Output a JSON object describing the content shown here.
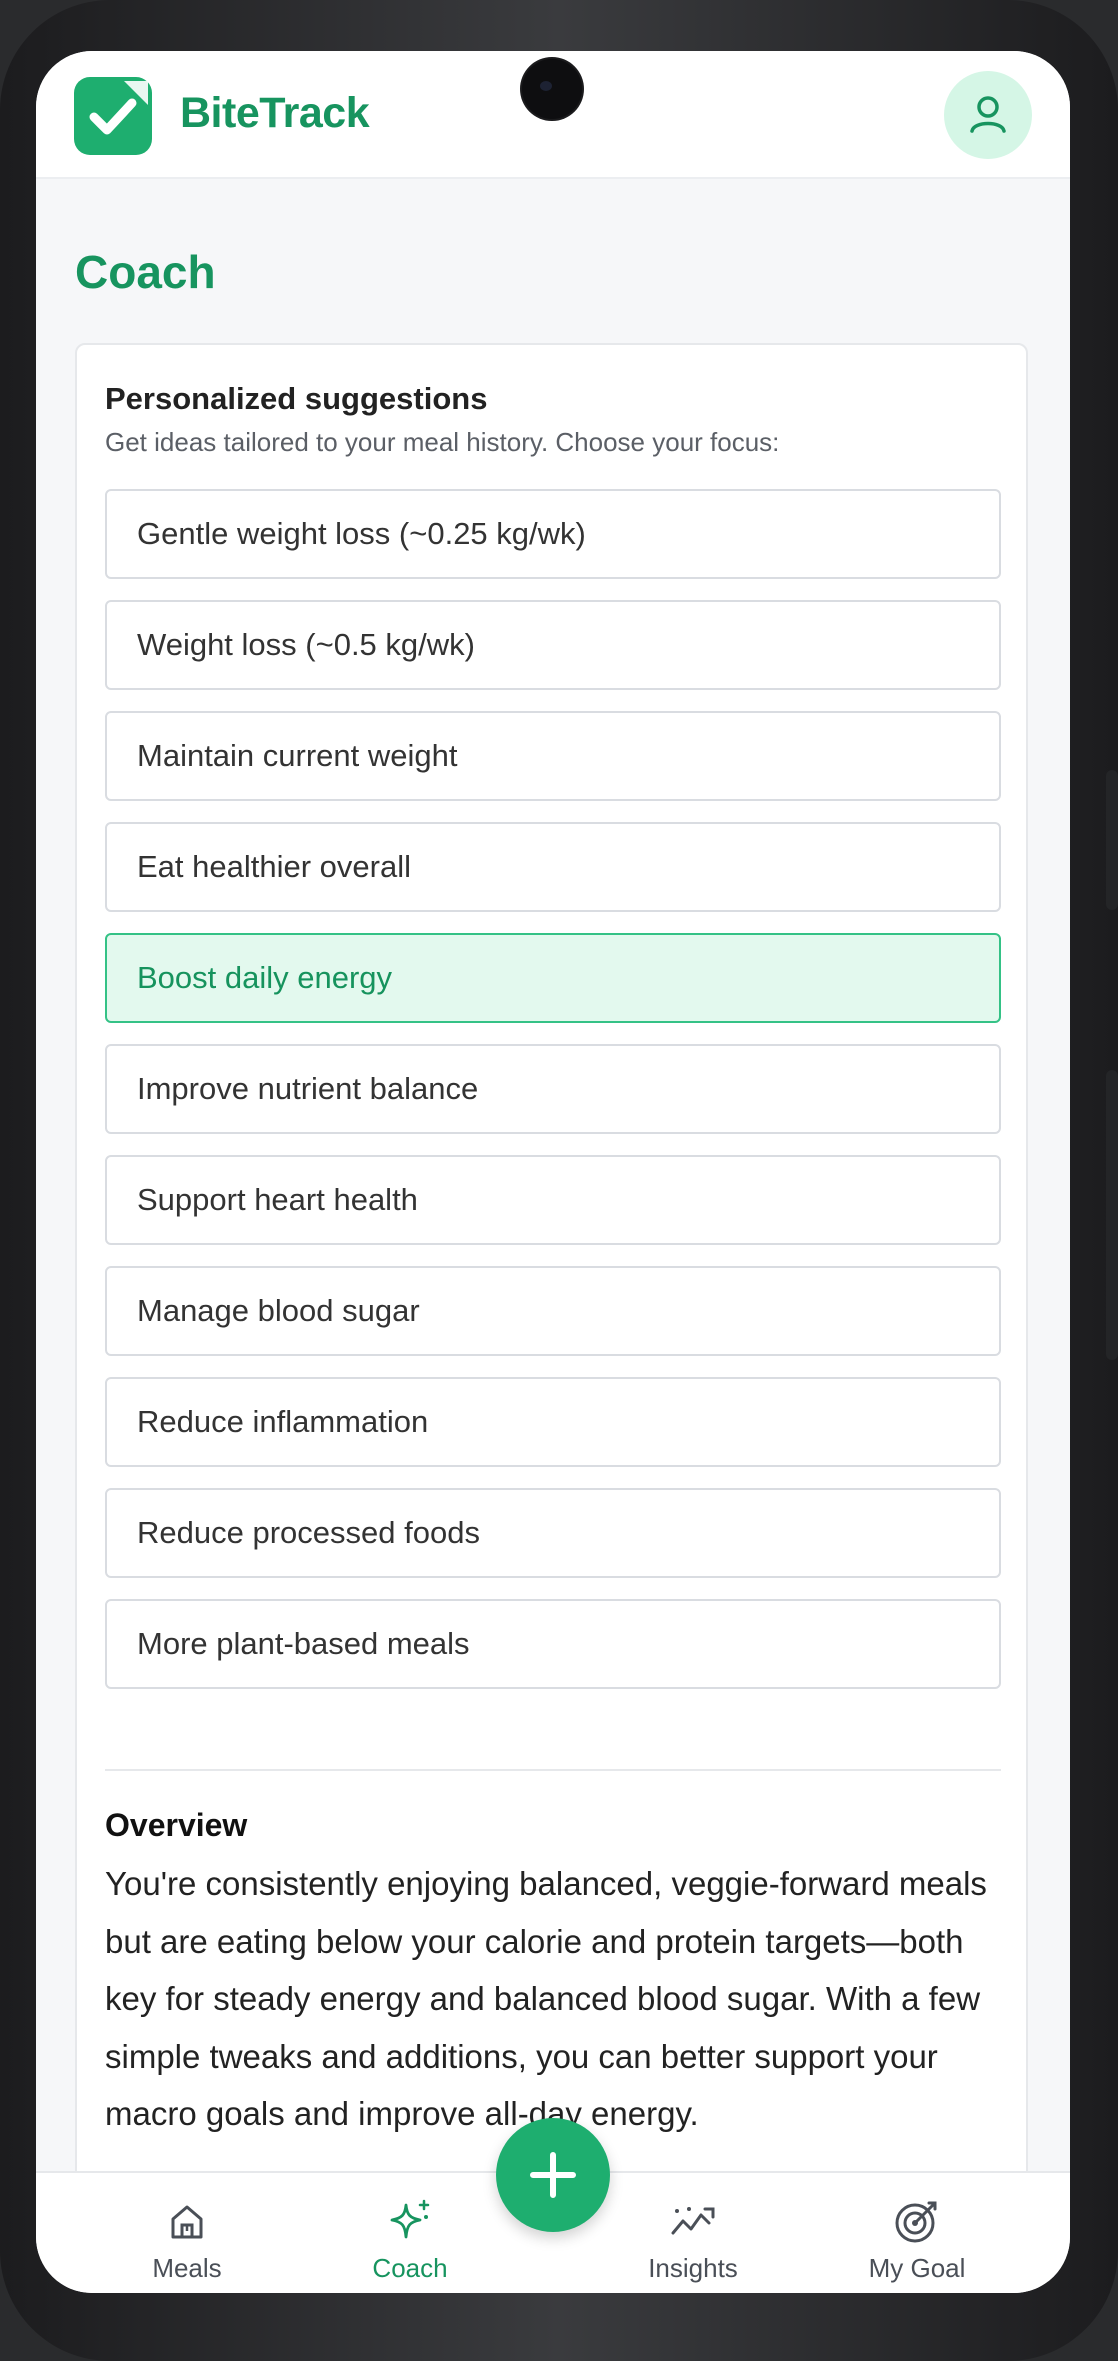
{
  "app": {
    "brand_name": "BiteTrack",
    "brand_color": "#1eae6f"
  },
  "header": {
    "avatar_icon": "user-icon"
  },
  "page": {
    "title": "Coach"
  },
  "suggestions": {
    "title": "Personalized suggestions",
    "subtitle": "Get ideas tailored to your meal history. Choose your focus:",
    "options": [
      {
        "label": "Gentle weight loss (~0.25 kg/wk)",
        "selected": false
      },
      {
        "label": "Weight loss (~0.5 kg/wk)",
        "selected": false
      },
      {
        "label": "Maintain current weight",
        "selected": false
      },
      {
        "label": "Eat healthier overall",
        "selected": false
      },
      {
        "label": "Boost daily energy",
        "selected": true
      },
      {
        "label": "Improve nutrient balance",
        "selected": false
      },
      {
        "label": "Support heart health",
        "selected": false
      },
      {
        "label": "Manage blood sugar",
        "selected": false
      },
      {
        "label": "Reduce inflammation",
        "selected": false
      },
      {
        "label": "Reduce processed foods",
        "selected": false
      },
      {
        "label": "More plant-based meals",
        "selected": false
      }
    ]
  },
  "overview": {
    "title": "Overview",
    "text": "You're consistently enjoying balanced, veggie-forward meals but are eating below your calorie and protein targets—both key for steady energy and balanced blood sugar. With a few simple tweaks and additions, you can better support your macro goals and improve all-day energy."
  },
  "nav": {
    "items": [
      {
        "label": "Meals",
        "icon": "home-icon",
        "active": false
      },
      {
        "label": "Coach",
        "icon": "sparkles-icon",
        "active": true
      },
      {
        "label": "Insights",
        "icon": "trend-chart-icon",
        "active": false
      },
      {
        "label": "My Goal",
        "icon": "target-icon",
        "active": false
      }
    ],
    "fab_icon": "plus-icon"
  }
}
